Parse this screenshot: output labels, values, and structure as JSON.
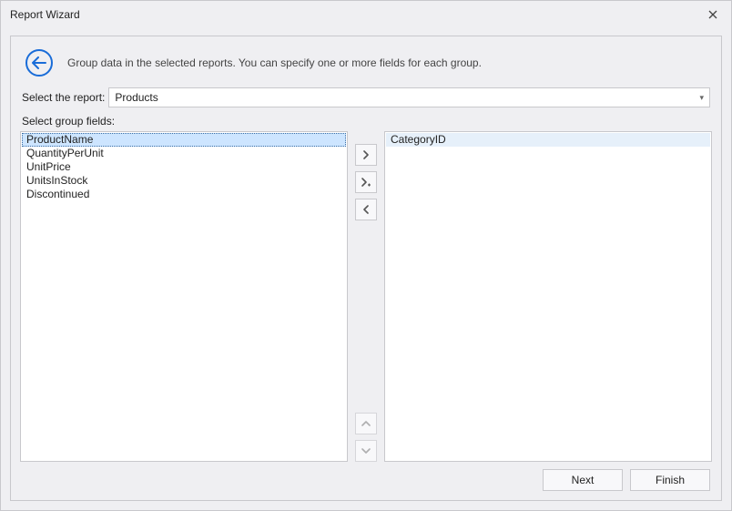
{
  "window": {
    "title": "Report Wizard"
  },
  "header": {
    "description": "Group data in the selected reports. You can specify one or more fields for each group."
  },
  "selectReport": {
    "label": "Select the report:",
    "value": "Products"
  },
  "fieldsLabel": "Select group fields:",
  "availableFields": [
    "ProductName",
    "QuantityPerUnit",
    "UnitPrice",
    "UnitsInStock",
    "Discontinued"
  ],
  "selectedFields": [
    "CategoryID"
  ],
  "buttons": {
    "next": "Next",
    "finish": "Finish"
  }
}
